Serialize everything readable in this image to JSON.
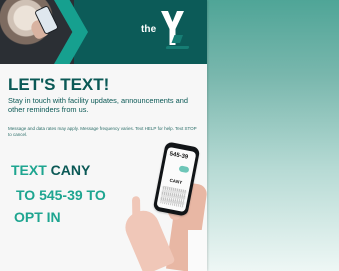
{
  "brand": {
    "prefix": "the",
    "letter": "Y",
    "colors": {
      "dark_teal": "#0c5b58",
      "accent_teal": "#1ea590",
      "background": "#f7f7f7"
    }
  },
  "flyer": {
    "title": "LET'S TEXT!",
    "intro": "Stay in touch with facility updates, announcements and other reminders from us.",
    "disclaimer": "Message and data rates may apply. Message frequency varies. Text HELP for help. Text STOP to cancel.",
    "cta": {
      "line1_prefix": "TEXT",
      "line1_keyword": "CANY",
      "line2": "TO 545-39 TO",
      "line3": "OPT IN"
    }
  },
  "phone": {
    "number": "545-39",
    "keyword": "CANY"
  }
}
